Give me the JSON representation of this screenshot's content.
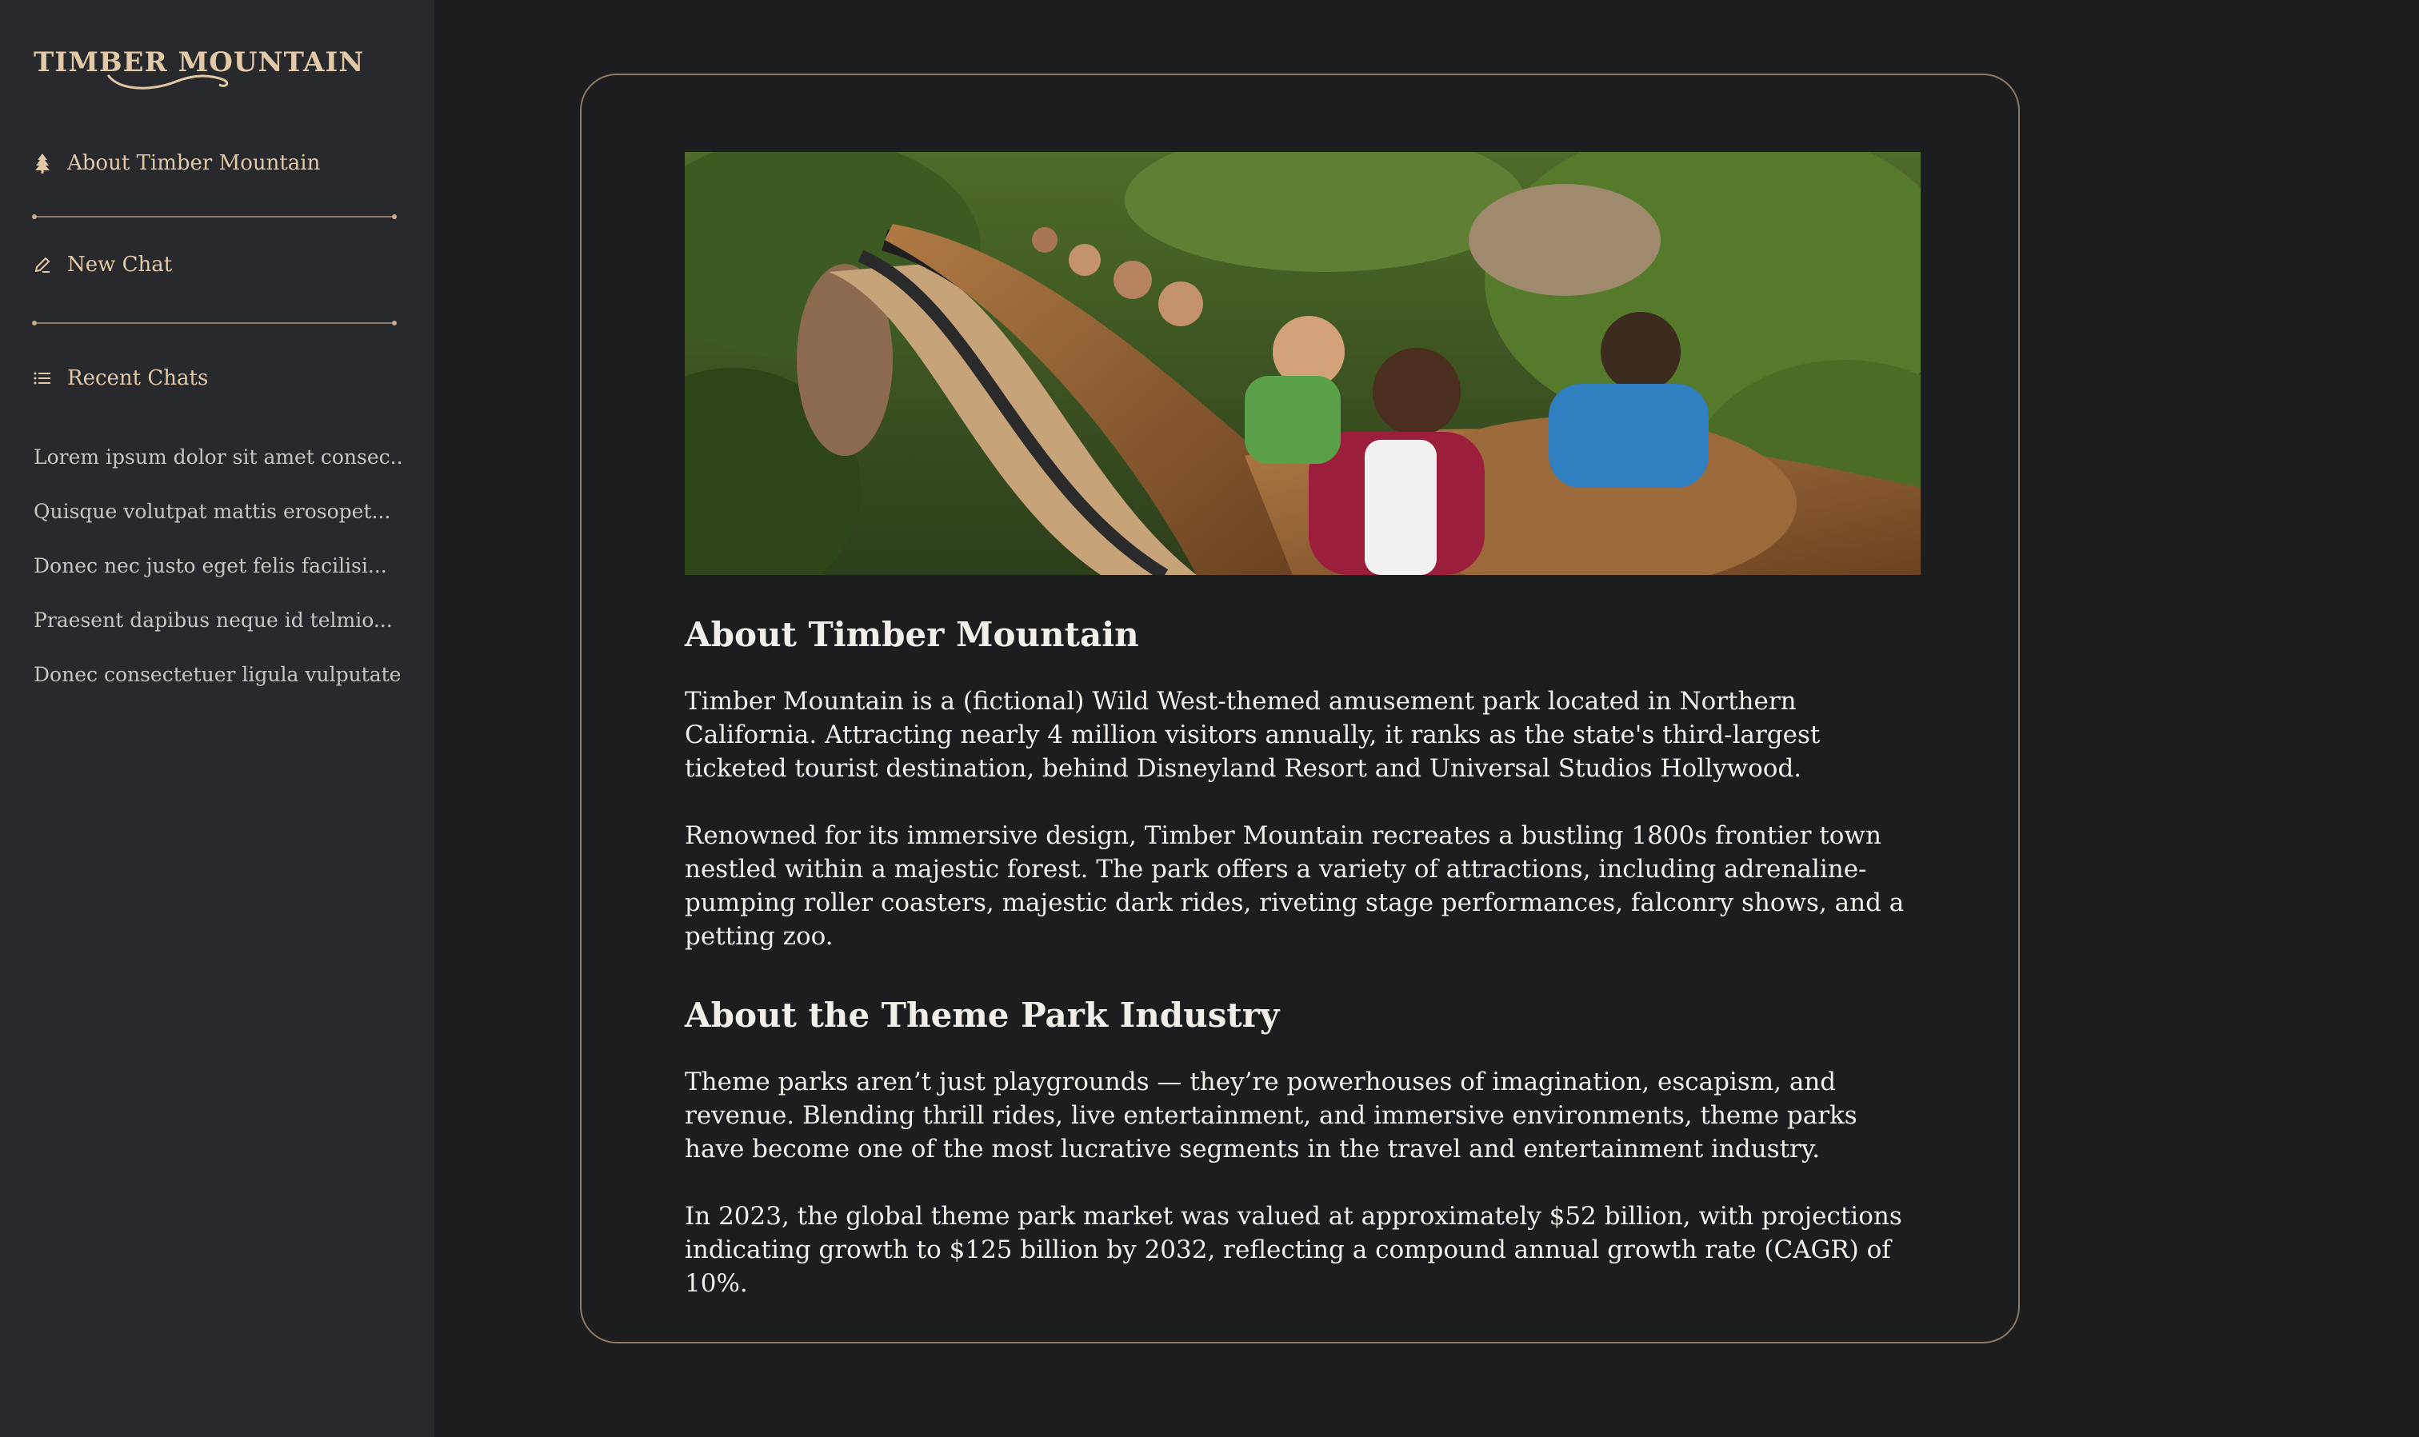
{
  "brand": {
    "logo_text": "TIMBER MOUNTAIN",
    "accent_color": "#e3c9a8",
    "border_color": "#8d7a63",
    "sidebar_bg": "#28292c",
    "page_bg": "#1c1d1f"
  },
  "sidebar": {
    "about": {
      "label": "About Timber Mountain",
      "icon": "tree-icon"
    },
    "new_chat": {
      "label": "New Chat",
      "icon": "pencil-icon"
    },
    "recent": {
      "label": "Recent Chats",
      "icon": "list-icon"
    },
    "recent_items": [
      "Lorem ipsum dolor sit amet consec...",
      "Quisque volutpat mattis erosopet...",
      "Donec nec justo eget felis facilisi...",
      "Praesent dapibus neque id telmio...",
      "Donec consectetuer ligula vulputate..."
    ]
  },
  "main": {
    "hero_image": "roller-coaster-riders",
    "section1": {
      "title": "About Timber Mountain",
      "p1": "Timber Mountain is a (fictional) Wild West-themed amusement park located in Northern California. Attracting nearly 4 million visitors annually, it ranks as the state's third-largest ticketed tourist destination, behind Disneyland Resort and Universal Studios Hollywood.",
      "p2": "Renowned for its immersive design, Timber Mountain recreates a bustling 1800s frontier town nestled within a majestic forest. The park offers a variety of attractions, including adrenaline-pumping roller coasters, majestic dark rides, riveting stage performances, falconry shows, and a petting zoo."
    },
    "section2": {
      "title": "About the Theme Park Industry",
      "p1": "Theme parks aren’t just playgrounds — they’re powerhouses of imagination, escapism, and revenue. Blending thrill rides, live entertainment, and immersive environments, theme parks have become one of the most lucrative segments in the travel and entertainment industry.",
      "p2": "In 2023, the global theme park market was valued at approximately $52 billion, with projections indicating growth to $125 billion by 2032, reflecting a compound annual growth rate (CAGR) of 10%."
    }
  }
}
